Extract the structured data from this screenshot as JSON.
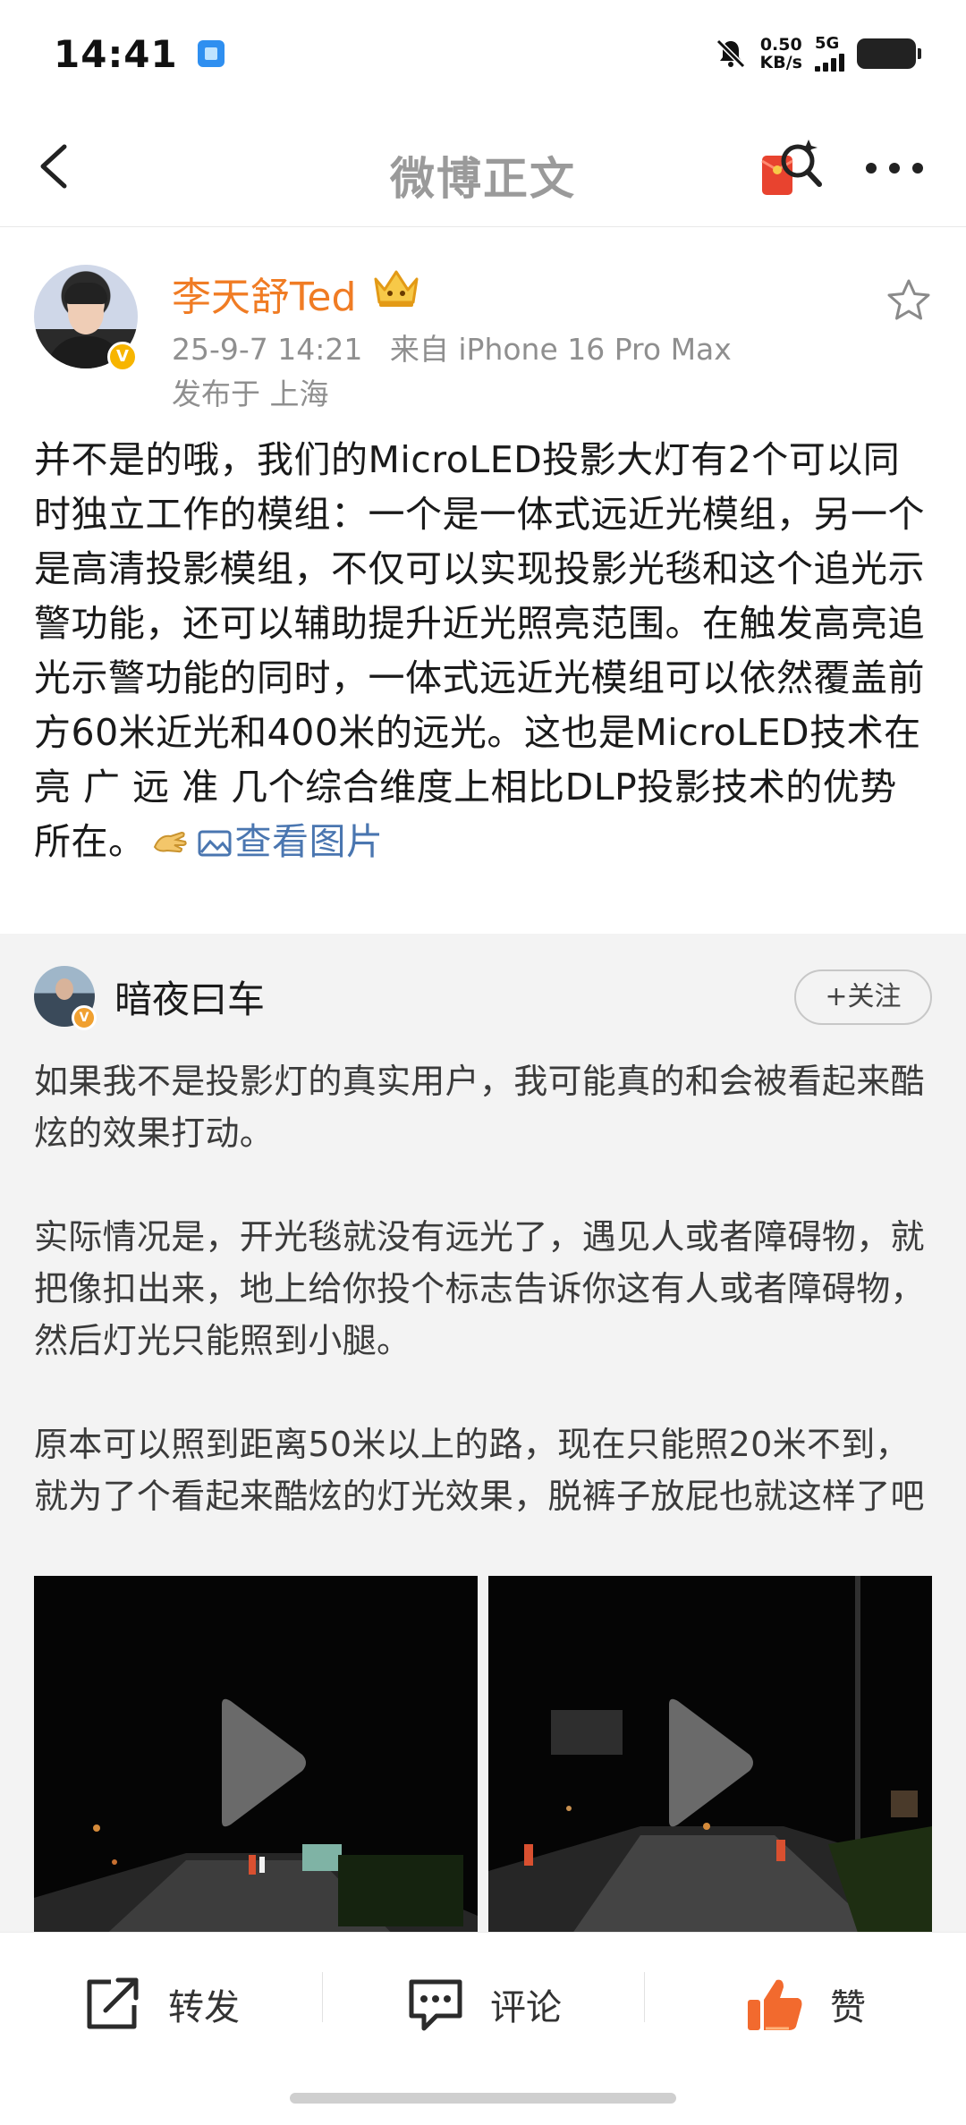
{
  "status_bar": {
    "time": "14:41",
    "speed_value": "0.50",
    "speed_unit": "KB/s",
    "network": "5G"
  },
  "nav": {
    "title": "微博正文",
    "icons": [
      "back-icon",
      "red-packet-search-icon",
      "more-icon"
    ]
  },
  "post": {
    "author": "李天舒Ted",
    "date": "25-9-7 14:21",
    "source": "来自 iPhone 16 Pro Max",
    "location": "发布于 上海",
    "text_main": "并不是的哦，我们的MicroLED投影大灯有2个可以同时独立工作的模组：一个是一体式远近光模组，另一个是高清投影模组，不仅可以实现投影光毯和这个追光示警功能，还可以辅助提升近光照亮范围。在触发高亮追光示警功能的同时，一体式远近光模组可以依然覆盖前方60米近光和400米的远光。这也是MicroLED技术在亮 广 远 准 几个综合维度上相比DLP投影技术的优势所在。",
    "link_text": "查看图片",
    "colors": {
      "author": "#f07c24",
      "link": "#4a76b0",
      "verified": "#f7b500"
    }
  },
  "repost": {
    "author": "暗夜曰车",
    "follow_label": "+关注",
    "paragraphs": [
      "如果我不是投影灯的真实用户，我可能真的和会被看起来酷炫的效果打动。",
      "实际情况是，开光毯就没有远光了，遇见人或者障碍物，就把像扣出来，地上给你投个标志告诉你这有人或者障碍物，然后灯光只能照到小腿。",
      "原本可以照到距离50米以上的路，现在只能照20米不到，就为了个看起来酷炫的灯光效果，脱裤子放屁也就这样了吧"
    ],
    "videos": [
      "video-1",
      "video-2"
    ]
  },
  "actions": {
    "repost": "转发",
    "comment": "评论",
    "like": "赞",
    "like_color": "#f26a2e"
  }
}
